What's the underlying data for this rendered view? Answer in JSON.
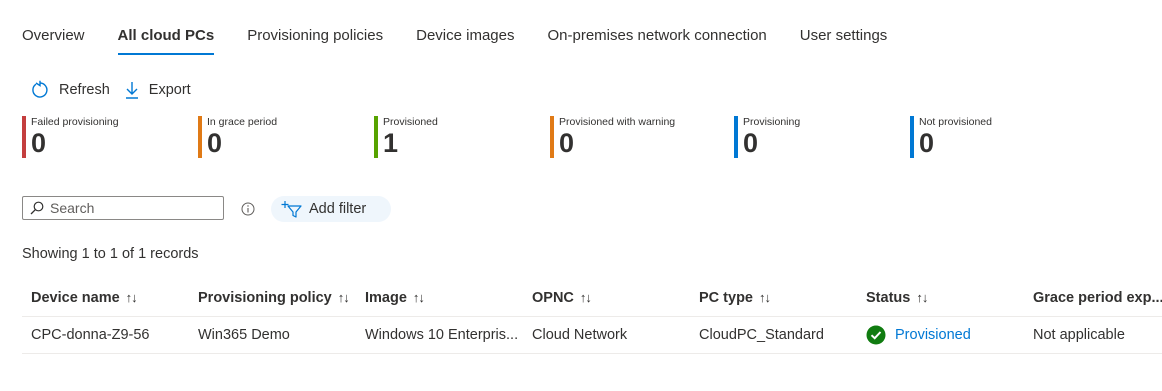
{
  "tabs": [
    {
      "label": "Overview",
      "active": false
    },
    {
      "label": "All cloud PCs",
      "active": true
    },
    {
      "label": "Provisioning policies",
      "active": false
    },
    {
      "label": "Device images",
      "active": false
    },
    {
      "label": "On-premises network connection",
      "active": false
    },
    {
      "label": "User settings",
      "active": false
    }
  ],
  "commands": {
    "refresh_label": "Refresh",
    "export_label": "Export"
  },
  "tiles": [
    {
      "label": "Failed provisioning",
      "value": "0",
      "color": "#c43e3e"
    },
    {
      "label": "In grace period",
      "value": "0",
      "color": "#e07a16"
    },
    {
      "label": "Provisioned",
      "value": "1",
      "color": "#57a300"
    },
    {
      "label": "Provisioned with warning",
      "value": "0",
      "color": "#e07a16"
    },
    {
      "label": "Provisioning",
      "value": "0",
      "color": "#0078d4"
    },
    {
      "label": "Not provisioned",
      "value": "0",
      "color": "#0078d4"
    }
  ],
  "search": {
    "placeholder": "Search",
    "value": ""
  },
  "filter": {
    "add_label": "Add filter"
  },
  "records_text": "Showing 1 to 1 of 1 records",
  "table": {
    "columns": [
      "Device name",
      "Provisioning policy",
      "Image",
      "OPNC",
      "PC type",
      "Status",
      "Grace period exp..."
    ],
    "rows": [
      {
        "device_name": "CPC-donna-Z9-56",
        "provisioning_policy": "Win365 Demo",
        "image": "Windows 10 Enterpris...",
        "opnc": "Cloud Network",
        "pc_type": "CloudPC_Standard",
        "status": "Provisioned",
        "grace_period": "Not applicable"
      }
    ]
  },
  "colors": {
    "accent": "#0078d4",
    "success": "#107c10"
  }
}
